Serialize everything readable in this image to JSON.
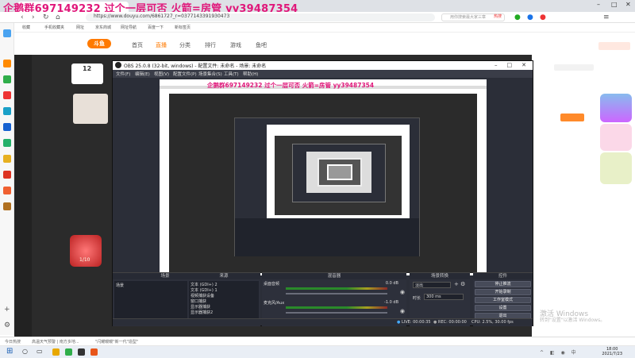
{
  "browser": {
    "overlay_title": "企鹅群697149232 过个一层可否 火箭=房管 yy39487354",
    "url": "https://www.douyu.com/6861727_r=0377143391930473",
    "search_placeholder": "用你搜索最大家三章",
    "hot_label": "热搜"
  },
  "bookmarks": [
    {
      "label": "收藏"
    },
    {
      "label": "手机收藏夹"
    },
    {
      "label": "网址"
    },
    {
      "label": "京东商城"
    },
    {
      "label": "网址导航"
    },
    {
      "label": "百度一下"
    },
    {
      "label": "新标签页"
    }
  ],
  "douyu": {
    "logo": "斗鱼",
    "nav": [
      "首页",
      "直播",
      "分类",
      "排行",
      "游戏",
      "鱼吧"
    ],
    "follow_count": "12",
    "ranking_label": "1/10"
  },
  "obs": {
    "title": "OBS 25.0.8 (32-bit, windows) - 配置文件: 未命名 - 场景: 未命名",
    "menus": [
      "文件(F)",
      "编辑(E)",
      "视图(V)",
      "配置文件(P)",
      "场景集合(S)",
      "工具(T)",
      "帮助(H)"
    ],
    "preview_caption": "企鹅群697149232 过个一层可否 火箭=房管 yy39487354",
    "docks": {
      "scenes_title": "场景",
      "sources_title": "来源",
      "mixer_title": "混音器",
      "transitions_title": "场景转换",
      "controls_title": "控件"
    },
    "scenes": [
      "场景"
    ],
    "sources": [
      "文本 (GDI+) 2",
      "文本 (GDI+) 1",
      "视频捕获设备",
      "窗口捕获",
      "显示器捕获",
      "显示器捕获2"
    ],
    "mixer": [
      {
        "label": "桌面音频",
        "db": "0.0 dB"
      },
      {
        "label": "麦克风/Aux",
        "db": "-1.0 dB"
      }
    ],
    "transition": {
      "type": "淡出",
      "duration_label": "时长",
      "duration_value": "300 ms"
    },
    "controls": [
      "停止推流",
      "开始录制",
      "工作室模式",
      "设置",
      "退出"
    ],
    "status": {
      "live": "LIVE: 00:00:35",
      "rec": "REC: 00:00:00",
      "cpu": "CPU: 2.5%, 30.00 fps"
    }
  },
  "watermark": {
    "line1": "激活 Windows",
    "line2": "转到\"设置\"以激活 Windows。"
  },
  "taskbar": {
    "status_left": "今日热搜",
    "status_mid": "高温天气预警 | 南方多地...",
    "status_right": "\"闪耀暖暖\"新一代\"造型\"",
    "time": "18:00",
    "date": "2021/7/23"
  },
  "colors": {
    "overlay_pink": "#e0177a",
    "obs_bg": "#2b2e38",
    "douyu_orange": "#ff7a00"
  }
}
